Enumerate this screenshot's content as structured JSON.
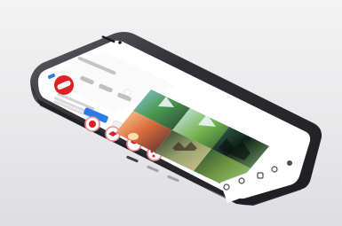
{
  "colors": {
    "background": "#ececee",
    "phone_frame": "#3a3b40",
    "screen": "#ffffff",
    "brand_red": "#dd1f26",
    "highlight_red": "#ef8b8f",
    "primary_blue": "#2a7be2"
  },
  "phone": {
    "device": "smartphone",
    "orientation": "portrait-tilted",
    "status": "mockup"
  },
  "screen": {
    "profile": {
      "avatar_icon": "brand-logo-icon"
    },
    "actions": {
      "follow_icon": "follow-button",
      "message_icon": "message-button"
    },
    "highlights": [
      {
        "icon_name": "highlight-1-icon"
      },
      {
        "icon_name": "highlight-2-icon"
      },
      {
        "icon_name": "highlight-3-icon"
      },
      {
        "icon_name": "highlight-4-icon"
      }
    ],
    "posts": [
      {
        "icon_name": "post-mountain-lake"
      },
      {
        "icon_name": "post-valley"
      },
      {
        "icon_name": "post-forest"
      },
      {
        "icon_name": "post-sunset"
      },
      {
        "icon_name": "post-bridge"
      },
      {
        "icon_name": "post-meadow"
      }
    ]
  }
}
